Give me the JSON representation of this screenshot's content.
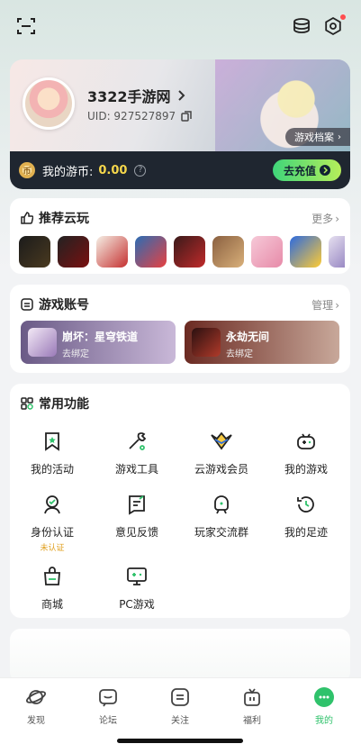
{
  "profile": {
    "name": "3322手游网",
    "uid": "UID: 927527897",
    "archive_label": "游戏档案",
    "coin_label": "我的游币:",
    "coin_value": "0.00",
    "recharge_label": "去充值"
  },
  "recommend": {
    "title": "推荐云玩",
    "more_label": "更多"
  },
  "accounts": {
    "title": "游戏账号",
    "manage_label": "管理",
    "items": [
      {
        "name": "崩坏：星穹铁道",
        "bind": "去绑定"
      },
      {
        "name": "永劫无间",
        "bind": "去绑定"
      }
    ]
  },
  "features": {
    "title": "常用功能",
    "items": [
      {
        "label": "我的活动",
        "icon": "bookmark-star-icon"
      },
      {
        "label": "游戏工具",
        "icon": "wrench-icon"
      },
      {
        "label": "云游戏会员",
        "icon": "vip-crown-icon"
      },
      {
        "label": "我的游戏",
        "icon": "gamepad-icon"
      },
      {
        "label": "身份认证",
        "icon": "id-verify-icon",
        "sub": "未认证"
      },
      {
        "label": "意见反馈",
        "icon": "feedback-icon"
      },
      {
        "label": "玩家交流群",
        "icon": "chat-group-icon"
      },
      {
        "label": "我的足迹",
        "icon": "history-icon"
      },
      {
        "label": "商城",
        "icon": "shop-bag-icon"
      },
      {
        "label": "PC游戏",
        "icon": "pc-game-icon"
      }
    ]
  },
  "tabs": [
    {
      "label": "发现",
      "icon": "planet-icon"
    },
    {
      "label": "论坛",
      "icon": "forum-icon"
    },
    {
      "label": "关注",
      "icon": "follow-icon"
    },
    {
      "label": "福利",
      "icon": "gift-icon"
    },
    {
      "label": "我的",
      "icon": "me-icon"
    }
  ],
  "colors": {
    "accent": "#2fc26b",
    "coin": "#f5d64b",
    "badge": "#ff4d4f"
  }
}
